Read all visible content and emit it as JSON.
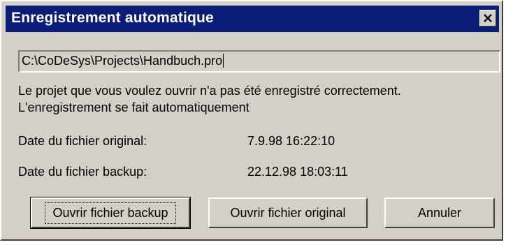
{
  "window": {
    "title": "Enregistrement automatique",
    "close_icon": "close-icon"
  },
  "path": {
    "value": "C:\\CoDeSys\\Projects\\Handbuch.pro"
  },
  "message": {
    "line1": "Le projet que vous voulez ouvrir n'a pas été enregistré correctement.",
    "line2": "L'enregistrement se fait automatiquement"
  },
  "dates": {
    "original_label": "Date du fichier original:",
    "original_value": "7.9.98 16:22:10",
    "backup_label": "Date du fichier backup:",
    "backup_value": "22.12.98 18:03:11"
  },
  "buttons": {
    "open_backup": "Ouvrir fichier backup",
    "open_original": "Ouvrir fichier original",
    "cancel": "Annuler"
  },
  "colors": {
    "titlebar": "#0a1e78",
    "face": "#d4d0c8"
  }
}
